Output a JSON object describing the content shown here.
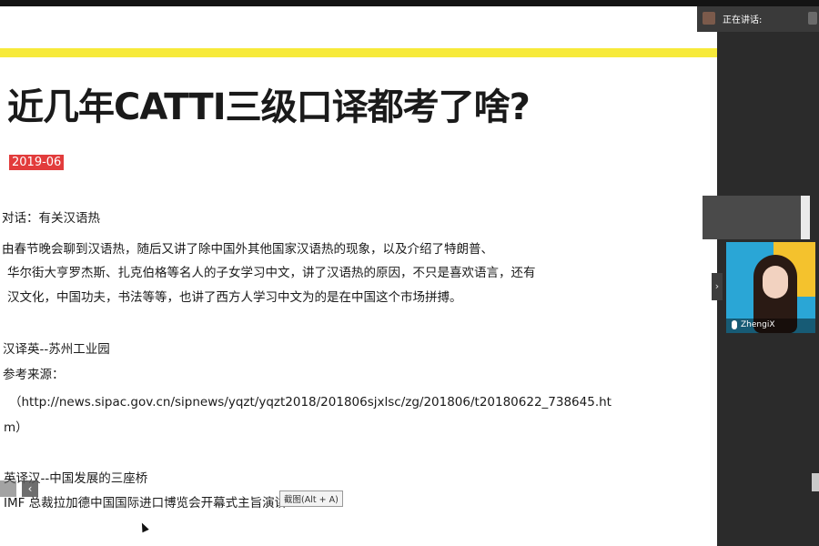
{
  "slide": {
    "title": "近几年CATTI三级口译都考了啥?",
    "date_badge": "2019-06",
    "lines": [
      "对话：有关汉语热",
      "由春节晚会聊到汉语热，随后又讲了除中国外其他国家汉语热的现象，以及介绍了特朗普、",
      "华尔街大亨罗杰斯、扎克伯格等名人的子女学习中文，讲了汉语热的原因，不只是喜欢语言，还有",
      "汉文化，中国功夫，书法等等，也讲了西方人学习中文为的是在中国这个市场拼搏。",
      "汉译英--苏州工业园",
      "参考来源：",
      "（http://news.sipac.gov.cn/sipnews/yqzt/yqzt2018/201806sjxlsc/zg/201806/t20180622_738645.ht",
      "m）",
      "英译汉--中国发展的三座桥",
      "IMF 总裁拉加德中国国际进口博览会开幕式主旨演讲"
    ],
    "snip_badge": "截图(Alt + A)",
    "left_arrow": "‹"
  },
  "panel": {
    "speaking_label": "正在讲话:",
    "participant_name": "ZhengiX",
    "collapse_arrow": "›"
  },
  "colors": {
    "accent_yellow": "#f7ea3a",
    "badge_red": "#e23c3c",
    "panel_dark": "#2b2b2b"
  }
}
